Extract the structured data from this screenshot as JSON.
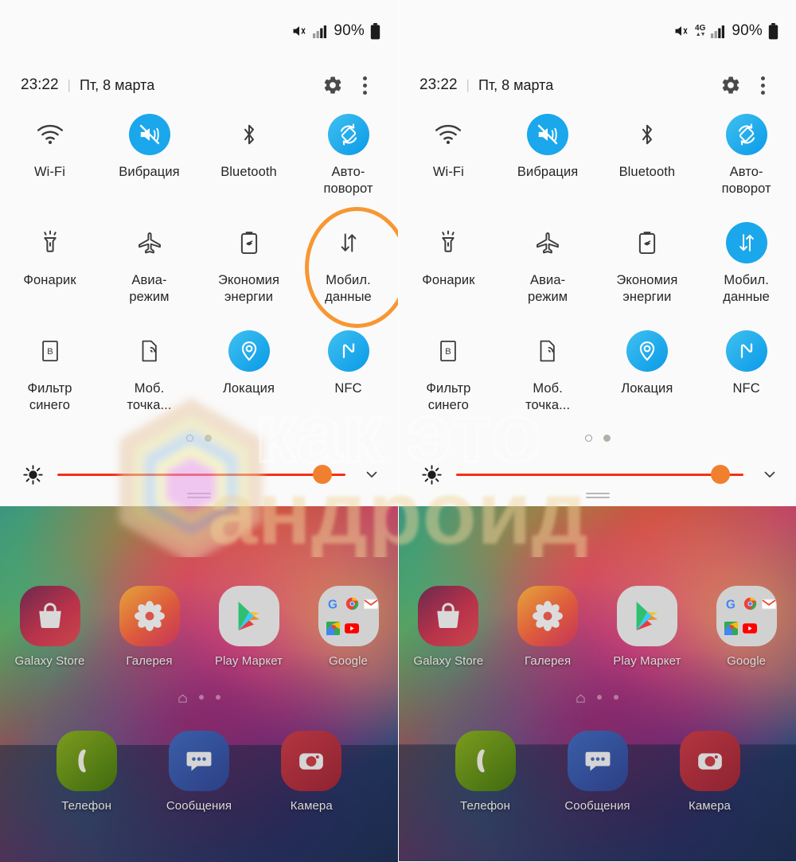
{
  "meta": {
    "accent_blue": "#1aa7ec",
    "highlight_orange": "#f79733",
    "slider_red": "#f52f18",
    "slider_thumb": "#f08030"
  },
  "panels": [
    {
      "id": "left",
      "status_bar": {
        "mute_icon": "volume-mute-icon",
        "has_4g": false,
        "network_label": "",
        "signal_icon": "signal-bars-icon",
        "battery_percent": "90%",
        "battery_icon": "battery-full-icon"
      },
      "header": {
        "time": "23:22",
        "separator": "|",
        "date": "Пт, 8 марта",
        "settings_icon": "gear-icon",
        "more_icon": "kebab-menu-icon"
      },
      "tiles": [
        [
          {
            "label": "Wi-Fi",
            "icon": "wifi-icon",
            "active": false
          },
          {
            "label": "Вибрация",
            "icon": "vibrate-mute-icon",
            "active": true
          },
          {
            "label": "Bluetooth",
            "icon": "bluetooth-icon",
            "active": false
          },
          {
            "label": "Авто-\nповорот",
            "icon": "auto-rotate-icon",
            "active": true
          }
        ],
        [
          {
            "label": "Фонарик",
            "icon": "flashlight-icon",
            "active": false
          },
          {
            "label": "Авиа-\nрежим",
            "icon": "airplane-icon",
            "active": false
          },
          {
            "label": "Экономия\nэнергии",
            "icon": "power-saving-icon",
            "active": false
          },
          {
            "label": "Мобил.\nданные",
            "icon": "mobile-data-icon",
            "active": false,
            "highlighted": true
          }
        ],
        [
          {
            "label": "Фильтр\nсинего",
            "icon": "blue-light-filter-icon",
            "active": false
          },
          {
            "label": "Моб.\nточка...",
            "icon": "mobile-hotspot-icon",
            "active": false
          },
          {
            "label": "Локация",
            "icon": "location-pin-icon",
            "active": true
          },
          {
            "label": "NFC",
            "icon": "nfc-icon",
            "active": true
          }
        ]
      ],
      "page_dots": {
        "count": 2,
        "current": 0
      },
      "brightness": {
        "icon": "brightness-icon",
        "value_percent": 92,
        "expand_icon": "chevron-down-icon"
      },
      "grabber_icon": "panel-grabber-icon"
    },
    {
      "id": "right",
      "status_bar": {
        "mute_icon": "volume-mute-icon",
        "has_4g": true,
        "network_label": "4G",
        "signal_icon": "signal-bars-icon",
        "battery_percent": "90%",
        "battery_icon": "battery-full-icon"
      },
      "header": {
        "time": "23:22",
        "separator": "|",
        "date": "Пт, 8 марта",
        "settings_icon": "gear-icon",
        "more_icon": "kebab-menu-icon"
      },
      "tiles": [
        [
          {
            "label": "Wi-Fi",
            "icon": "wifi-icon",
            "active": false
          },
          {
            "label": "Вибрация",
            "icon": "vibrate-mute-icon",
            "active": true
          },
          {
            "label": "Bluetooth",
            "icon": "bluetooth-icon",
            "active": false
          },
          {
            "label": "Авто-\nповорот",
            "icon": "auto-rotate-icon",
            "active": true
          }
        ],
        [
          {
            "label": "Фонарик",
            "icon": "flashlight-icon",
            "active": false
          },
          {
            "label": "Авиа-\nрежим",
            "icon": "airplane-icon",
            "active": false
          },
          {
            "label": "Экономия\nэнергии",
            "icon": "power-saving-icon",
            "active": false
          },
          {
            "label": "Мобил.\nданные",
            "icon": "mobile-data-icon",
            "active": true
          }
        ],
        [
          {
            "label": "Фильтр\nсинего",
            "icon": "blue-light-filter-icon",
            "active": false
          },
          {
            "label": "Моб.\nточка...",
            "icon": "mobile-hotspot-icon",
            "active": false
          },
          {
            "label": "Локация",
            "icon": "location-pin-icon",
            "active": true
          },
          {
            "label": "NFC",
            "icon": "nfc-icon",
            "active": true
          }
        ]
      ],
      "page_dots": {
        "count": 2,
        "current": 0
      },
      "brightness": {
        "icon": "brightness-icon",
        "value_percent": 92,
        "expand_icon": "chevron-down-icon"
      },
      "grabber_icon": "panel-grabber-icon"
    }
  ],
  "home_screen": {
    "rows": [
      [
        {
          "label": "Galaxy Store",
          "icon": "galaxy-store-icon"
        },
        {
          "label": "Галерея",
          "icon": "gallery-icon"
        },
        {
          "label": "Play Маркет",
          "icon": "play-store-icon"
        },
        {
          "label": "Google",
          "icon": "google-folder-icon"
        }
      ],
      [
        {
          "label": "Телефон",
          "icon": "phone-icon"
        },
        {
          "label": "Сообщения",
          "icon": "messages-icon"
        },
        {
          "label": "Камера",
          "icon": "camera-icon"
        }
      ]
    ],
    "page_indicator": {
      "count": 3,
      "home_icon": "home-icon"
    }
  },
  "watermark": {
    "line1": "как это",
    "line2": "андроид",
    "logo": "hexagon-logo"
  }
}
